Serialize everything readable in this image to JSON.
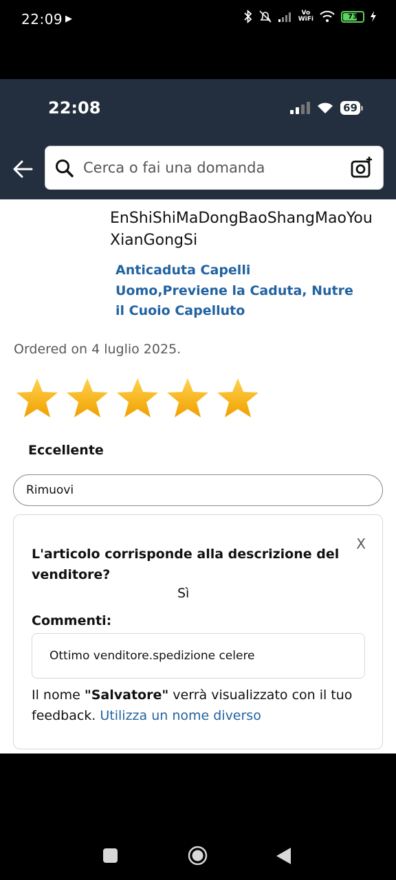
{
  "os_status": {
    "time": "22:09",
    "vowifi_top": "Vo",
    "vowifi_bottom": "WiFi",
    "battery": "73"
  },
  "app_status": {
    "time": "22:08",
    "battery": "69"
  },
  "search": {
    "placeholder": "Cerca o fai una domanda"
  },
  "order": {
    "seller_name": "EnShiShiMaDongBaoShangMaoYouXianGongSi",
    "product_title": "Anticaduta Capelli Uomo,Previene la Caduta, Nutre il Cuoio Capelluto",
    "ordered_text": "Ordered on 4 luglio 2025."
  },
  "rating": {
    "stars": 5,
    "max_stars": 5,
    "label": "Eccellente",
    "remove_label": "Rimuovi"
  },
  "feedback_card": {
    "close_label": "X",
    "question": "L'articolo corrisponde alla descrizione del venditore?",
    "answer": "Sì",
    "comments_label": "Commenti:",
    "comment_text": "Ottimo venditore.spedizione celere",
    "name_prefix": "Il nome ",
    "name_value": "\"Salvatore\"",
    "name_suffix": " verrà visualizzato con il tuo feedback. ",
    "change_name_link": "Utilizza un nome diverso"
  },
  "colors": {
    "header_bg": "#232f3e",
    "link": "#2162a1",
    "star": "#f5b400"
  }
}
